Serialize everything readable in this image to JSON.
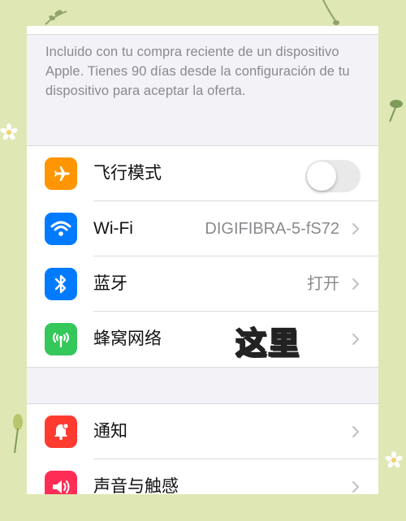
{
  "offer_note": "Incluido con tu compra reciente de un dispositivo Apple. Tienes 90 días desde la configuración de tu dispositivo para aceptar la oferta.",
  "connectivity": {
    "airplane": {
      "label": "飞行模式",
      "icon": "airplane-icon",
      "color": "#ff9500",
      "toggle_on": false
    },
    "wifi": {
      "label": "Wi-Fi",
      "value": "DIGIFIBRA-5-fS72",
      "icon": "wifi-icon",
      "color": "#007aff"
    },
    "bluetooth": {
      "label": "蓝牙",
      "value": "打开",
      "icon": "bluetooth-icon",
      "color": "#007aff"
    },
    "cellular": {
      "label": "蜂窝网络",
      "icon": "cellular-antenna-icon",
      "color": "#34c759"
    }
  },
  "notifications_group": {
    "notifications": {
      "label": "通知",
      "icon": "bell-icon",
      "color": "#ff3b30"
    },
    "sounds": {
      "label": "声音与触感",
      "icon": "speaker-icon",
      "color": "#ff2d55"
    }
  },
  "overlay_caption": "这里"
}
